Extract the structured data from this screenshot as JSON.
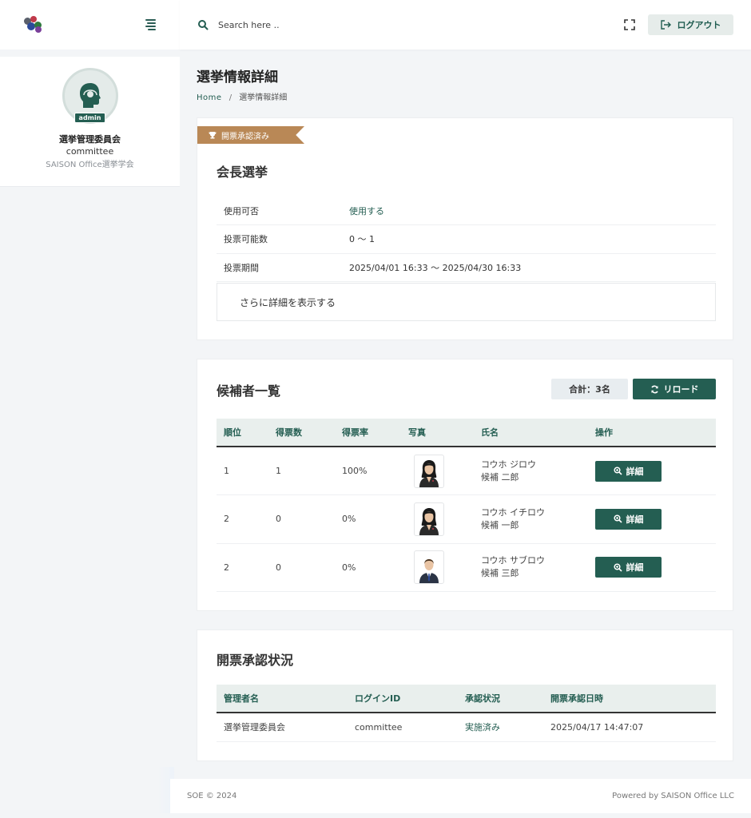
{
  "topbar": {
    "search_placeholder": "Search here ..",
    "logout_label": "ログアウト"
  },
  "profile": {
    "badge": "admin",
    "name": "選挙管理委員会",
    "login_id": "committee",
    "org": "SAISON Office選挙学会"
  },
  "page": {
    "title": "選挙情報詳細",
    "breadcrumb_home": "Home",
    "breadcrumb_sep": "/",
    "breadcrumb_current": "選挙情報詳細"
  },
  "election": {
    "ribbon_label": "開票承認済み",
    "title": "会長選挙",
    "rows": [
      {
        "label": "使用可否",
        "value": "使用する"
      },
      {
        "label": "投票可能数",
        "value": "0 〜 1"
      },
      {
        "label": "投票期間",
        "value": "2025/04/01 16:33 〜 2025/04/30 16:33"
      }
    ],
    "more_label": "さらに詳細を表示する"
  },
  "candidates": {
    "title": "候補者一覧",
    "total_label": "合計：3名",
    "reload_label": "リロード",
    "headers": [
      "順位",
      "得票数",
      "得票率",
      "写真",
      "氏名",
      "操作"
    ],
    "detail_label": "詳細",
    "rows": [
      {
        "rank": "1",
        "votes": "1",
        "rate": "100%",
        "kana": "コウホ ジロウ",
        "name": "候補 二郎",
        "photo": "female-avatar"
      },
      {
        "rank": "2",
        "votes": "0",
        "rate": "0%",
        "kana": "コウホ イチロウ",
        "name": "候補 一郎",
        "photo": "female-avatar"
      },
      {
        "rank": "2",
        "votes": "0",
        "rate": "0%",
        "kana": "コウホ サブロウ",
        "name": "候補 三郎",
        "photo": "male-avatar"
      }
    ]
  },
  "approval": {
    "title": "開票承認状況",
    "headers": [
      "管理者名",
      "ログインID",
      "承認状況",
      "開票承認日時"
    ],
    "rows": [
      {
        "admin": "選挙管理委員会",
        "login_id": "committee",
        "status": "実施済み",
        "datetime": "2025/04/17 14:47:07"
      }
    ]
  },
  "footer": {
    "left": "SOE © 2024",
    "right": "Powered by SAISON Office LLC"
  },
  "colors": {
    "accent": "#245e52",
    "ribbon": "#b98856"
  }
}
